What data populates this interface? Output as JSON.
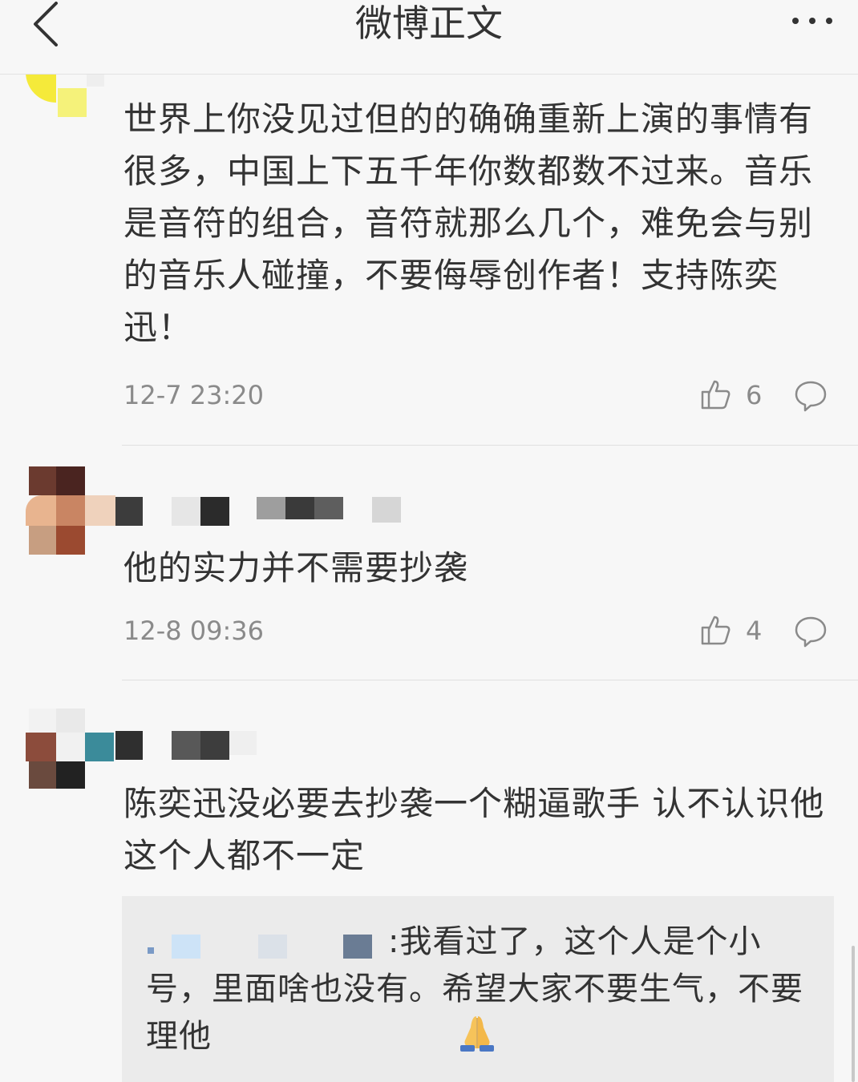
{
  "header": {
    "title": "微博正文"
  },
  "comments": [
    {
      "text": "世界上你没见过但的的确确重新上演的事情有很多，中国上下五千年你数都数不过来。音乐是音符的组合，音符就那么几个，难免会与别的音乐人碰撞，不要侮辱创作者！支持陈奕迅！",
      "time": "12-7 23:20",
      "likes": "6"
    },
    {
      "text": "他的实力并不需要抄袭",
      "time": "12-8 09:36",
      "likes": "4"
    },
    {
      "text": "陈奕迅没必要去抄袭一个糊逼歌手 认不认识他这个人都不一定",
      "reply": {
        "text": ":我看过了，这个人是个小号，里面啥也没有。希望大家不要生气，不要理他"
      }
    }
  ],
  "icons": {
    "back": "chevron-left-icon",
    "more": "more-dots-icon",
    "like": "thumbs-up-icon",
    "reply": "speech-bubble-icon",
    "emoji": "praying-hands-emoji"
  },
  "colors": {
    "text": "#333333",
    "meta": "#8a8a8a",
    "background": "#f7f7f7",
    "reply_bg": "#ebebeb"
  }
}
